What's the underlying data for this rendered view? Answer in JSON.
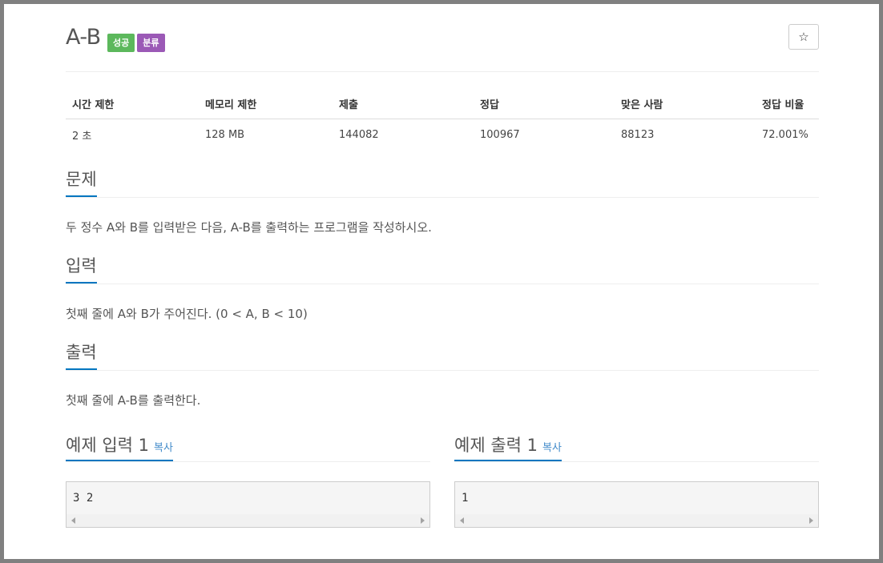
{
  "problem": {
    "title": "A-B",
    "badges": {
      "success": "성공",
      "category": "분류"
    },
    "star": "☆"
  },
  "stats": {
    "headers": [
      "시간 제한",
      "메모리 제한",
      "제출",
      "정답",
      "맞은 사람",
      "정답 비율"
    ],
    "values": [
      "2 초",
      "128 MB",
      "144082",
      "100967",
      "88123",
      "72.001%"
    ]
  },
  "sections": {
    "description": {
      "title": "문제",
      "body": "두 정수 A와 B를 입력받은 다음, A-B를 출력하는 프로그램을 작성하시오."
    },
    "input": {
      "title": "입력",
      "body": "첫째 줄에 A와 B가 주어진다. (0 < A, B < 10)"
    },
    "output": {
      "title": "출력",
      "body": "첫째 줄에 A-B를 출력한다."
    }
  },
  "samples": {
    "input": {
      "title": "예제 입력 1",
      "copy": "복사",
      "content": "3 2"
    },
    "output": {
      "title": "예제 출력 1",
      "copy": "복사",
      "content": "1"
    }
  }
}
